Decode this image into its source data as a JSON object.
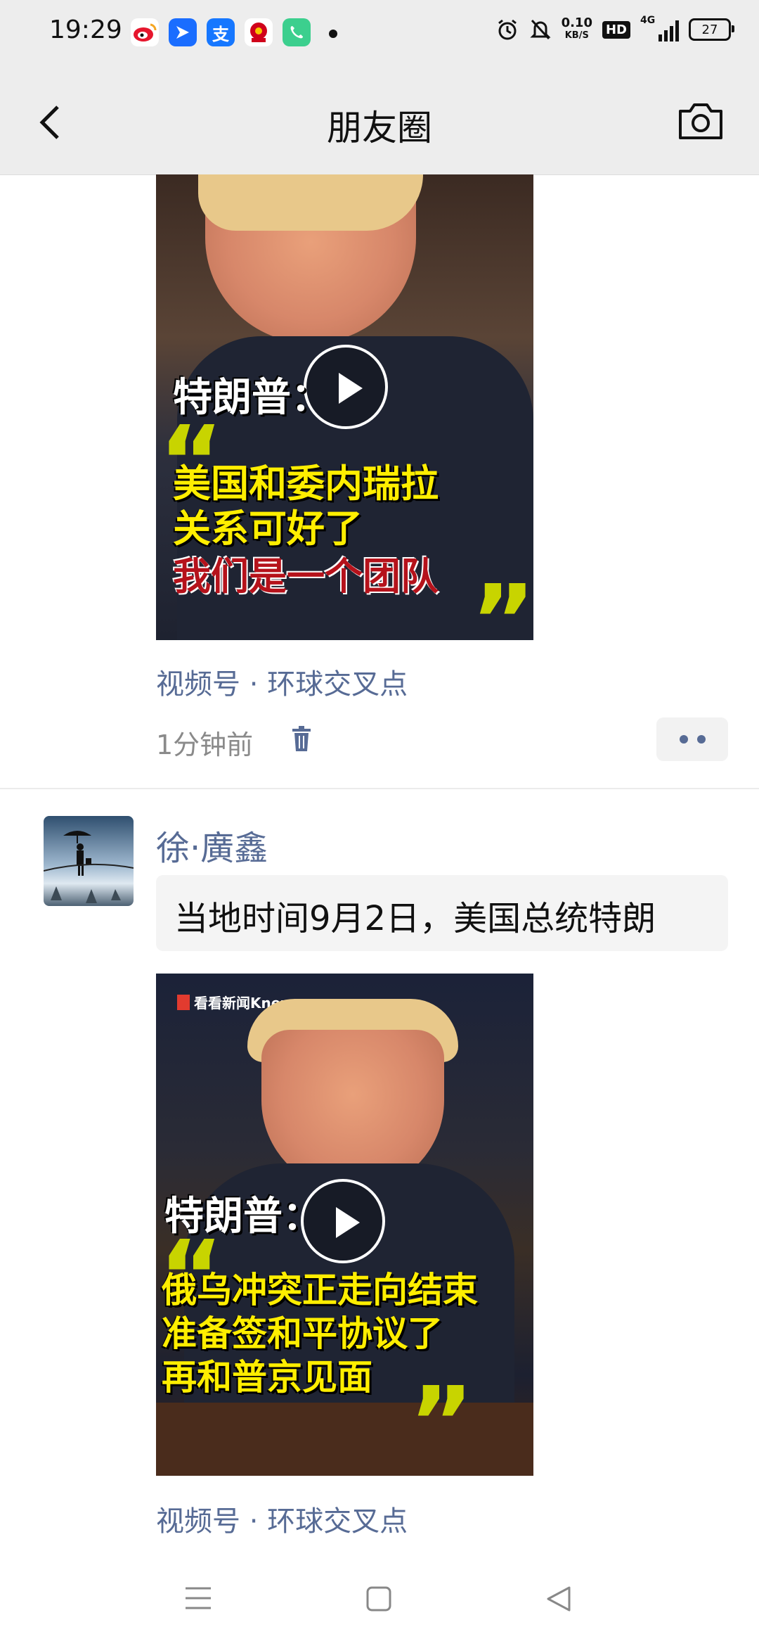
{
  "status_bar": {
    "time": "19:29",
    "net_speed": "0.10",
    "net_unit": "KB/S",
    "hd": "HD",
    "network": "4G",
    "battery": "27",
    "app_icons": [
      "weibo-icon",
      "feishu-icon",
      "alipay-icon",
      "gov-app-icon",
      "phone-icon"
    ]
  },
  "nav": {
    "title": "朋友圈"
  },
  "posts": [
    {
      "video": {
        "speaker": "特朗普：",
        "lines": [
          "美国和委内瑞拉",
          "关系可好了",
          "我们是一个团队"
        ]
      },
      "source": "视频号 · 环球交叉点",
      "time": "1分钟前"
    },
    {
      "username": "徐·廣鑫",
      "text": "当地时间9月2日，美国总统特朗",
      "video": {
        "brand": "看看新闻Knews",
        "speaker": "特朗普：",
        "lines": [
          "俄乌冲突正走向结束",
          "准备签和平协议了",
          "再和普京见面"
        ]
      },
      "source": "视频号 · 环球交叉点"
    }
  ],
  "colors": {
    "link": "#576b95",
    "bar": "#ededed",
    "quote_yellow": "#ffee00",
    "quote_red": "#b5121b"
  }
}
